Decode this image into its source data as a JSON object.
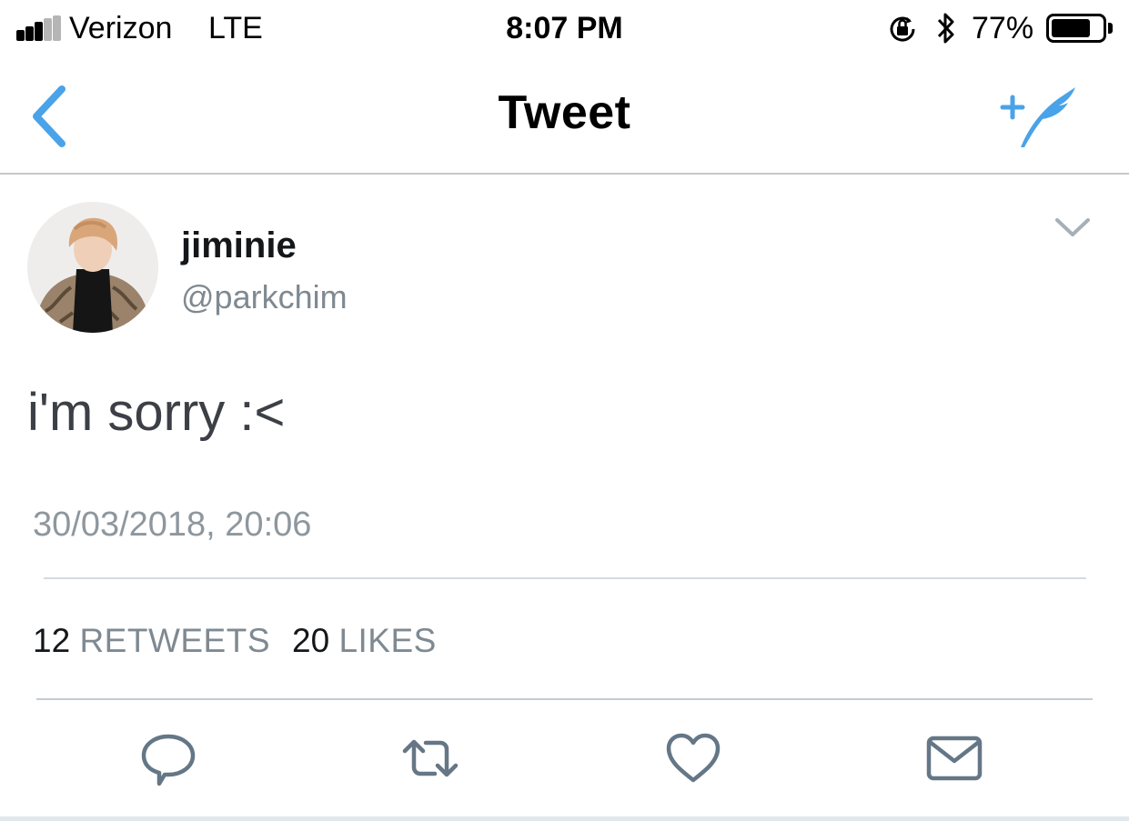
{
  "status_bar": {
    "carrier": "Verizon",
    "network": "LTE",
    "time": "8:07 PM",
    "battery_percent": "77%",
    "battery_level": 0.77,
    "signal_bars_filled": 3,
    "signal_bars_total": 5,
    "icons": [
      "orientation-lock-icon",
      "bluetooth-icon",
      "battery-icon"
    ]
  },
  "nav": {
    "title": "Tweet",
    "back_icon": "chevron-left-icon",
    "compose_icon": "compose-feather-icon"
  },
  "tweet": {
    "display_name": "jiminie",
    "handle": "@parkchim",
    "text": "i'm sorry :<",
    "timestamp": "30/03/2018, 20:06",
    "retweets_count": "12",
    "retweets_label": "RETWEETS",
    "likes_count": "20",
    "likes_label": "LIKES",
    "menu_icon": "chevron-down-icon"
  },
  "actions": [
    {
      "name": "reply",
      "icon": "reply-bubble-icon"
    },
    {
      "name": "retweet",
      "icon": "retweet-icon"
    },
    {
      "name": "like",
      "icon": "heart-icon"
    },
    {
      "name": "direct-message",
      "icon": "envelope-icon"
    }
  ],
  "colors": {
    "accent": "#4aa3e8",
    "text_primary": "#14171a",
    "text_secondary": "#7f8991",
    "icon_gray": "#657786",
    "divider": "#d6dbdf"
  }
}
